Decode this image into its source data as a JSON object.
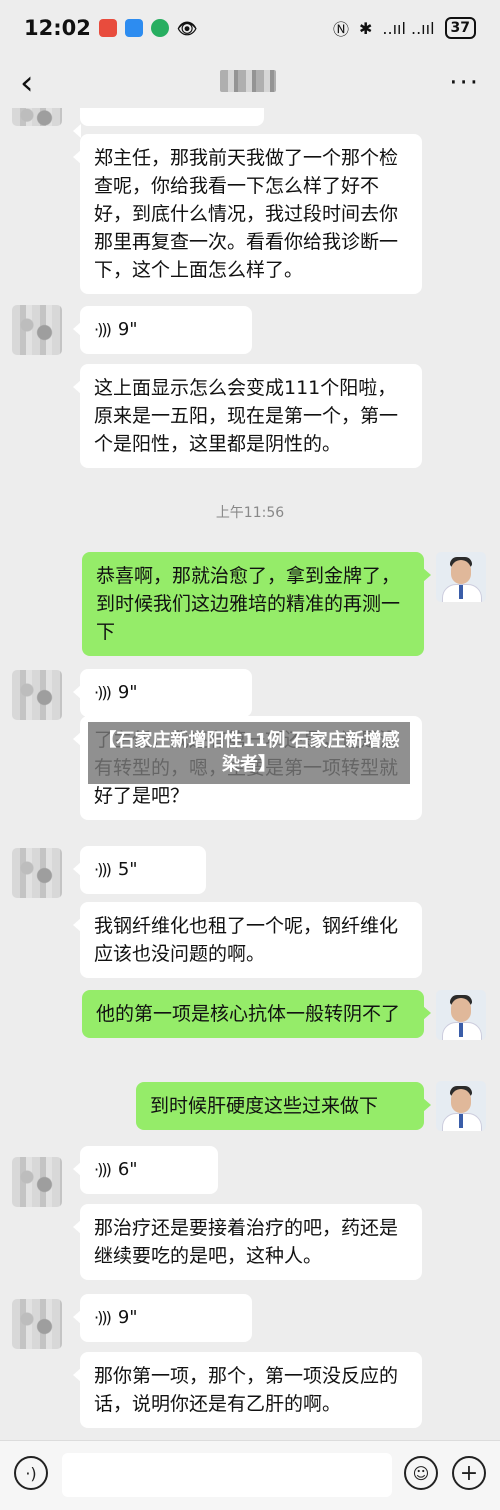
{
  "status_bar": {
    "time": "12:02",
    "battery": "37",
    "signal_text": "..ııl ..ııl"
  },
  "header": {
    "back_icon": "‹",
    "more_icon": "···"
  },
  "messages": [
    {
      "type": "text",
      "side": "left",
      "text": "郑主任，那我前天我做了一个那个检查呢，你给我看一下怎么样了好不好，到底什么情况，我过段时间去你那里再复查一次。看看你给我诊断一下，这个上面怎么样了。"
    },
    {
      "type": "voice",
      "side": "left",
      "duration": "9\""
    },
    {
      "type": "text",
      "side": "left",
      "text": "这上面显示怎么会变成111个阳啦，原来是一五阳，现在是第一个，第一个是阳性，这里都是阴性的。"
    },
    {
      "type": "timestamp",
      "text": "上午11:56"
    },
    {
      "type": "text",
      "side": "right",
      "text": "恭喜啊，那就治愈了，拿到金牌了，到时候我们这边雅培的精准的再测一下"
    },
    {
      "type": "voice",
      "side": "left",
      "duration": "9\""
    },
    {
      "type": "text",
      "side": "left",
      "text": "了主任，我还有第一项还是，还是没有转型的，嗯，主要是第一项转型就好了是吧？"
    },
    {
      "type": "voice",
      "side": "left",
      "duration": "5\""
    },
    {
      "type": "text",
      "side": "left",
      "text": "我钢纤维化也租了一个呢，钢纤维化应该也没问题的啊。"
    },
    {
      "type": "text",
      "side": "right",
      "text": "他的第一项是核心抗体一般转阴不了"
    },
    {
      "type": "text",
      "side": "right",
      "text": "到时候肝硬度这些过来做下"
    },
    {
      "type": "voice",
      "side": "left",
      "duration": "6\""
    },
    {
      "type": "text",
      "side": "left",
      "text": "那治疗还是要接着治疗的吧，药还是继续要吃的是吧，这种人。"
    },
    {
      "type": "voice",
      "side": "left",
      "duration": "9\""
    },
    {
      "type": "text",
      "side": "left",
      "text": "那你第一项，那个，第一项没反应的话，说明你还是有乙肝的啊。"
    }
  ],
  "overlay_caption": "【石家庄新增阳性11例 石家庄新增感染者】",
  "input_bar": {
    "voice_icon": "voice-mode-icon",
    "emoji_icon": "emoji-icon",
    "plus_icon": "plus-icon"
  },
  "colors": {
    "background": "#ededed",
    "left_bubble": "#ffffff",
    "right_bubble": "#95ec69"
  }
}
